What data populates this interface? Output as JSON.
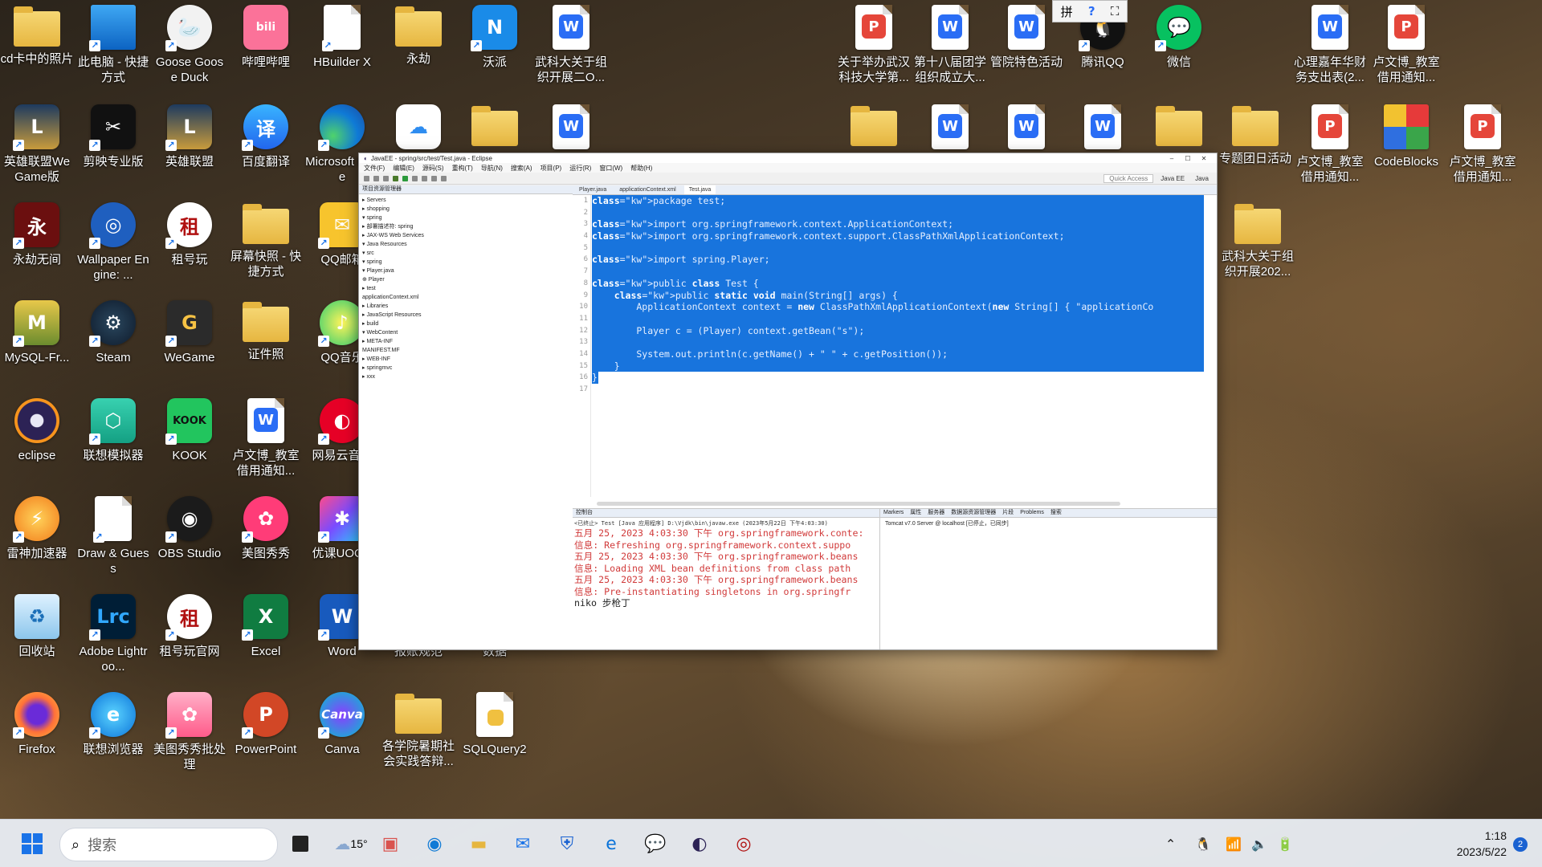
{
  "desktop": {
    "icons": [
      {
        "label": "cd卡中的照片"
      },
      {
        "label": "此电脑 - 快捷方式"
      },
      {
        "label": "Goose Goose Duck"
      },
      {
        "label": "哔哩哔哩"
      },
      {
        "label": "HBuilder X"
      },
      {
        "label": "永劫"
      },
      {
        "label": "沃派"
      },
      {
        "label": "武科大关于组织开展二O..."
      },
      {
        "label": "英雄联盟WeGame版"
      },
      {
        "label": "剪映专业版"
      },
      {
        "label": "英雄联盟"
      },
      {
        "label": "百度翻译"
      },
      {
        "label": "Microsoft Edge"
      },
      {
        "label": "永劫无间"
      },
      {
        "label": "Wallpaper Engine: ..."
      },
      {
        "label": "租号玩"
      },
      {
        "label": "屏幕快照 - 快捷方式"
      },
      {
        "label": "QQ邮箱"
      },
      {
        "label": "MySQL-Fr..."
      },
      {
        "label": "Steam"
      },
      {
        "label": "WeGame"
      },
      {
        "label": "证件照"
      },
      {
        "label": "QQ音乐"
      },
      {
        "label": "eclipse"
      },
      {
        "label": "联想模拟器"
      },
      {
        "label": "KOOK"
      },
      {
        "label": "卢文博_教室借用通知..."
      },
      {
        "label": "网易云音乐"
      },
      {
        "label": "雷神加速器"
      },
      {
        "label": "Draw & Guess"
      },
      {
        "label": "OBS Studio"
      },
      {
        "label": "美图秀秀"
      },
      {
        "label": "优课UOOC"
      },
      {
        "label": "回收站"
      },
      {
        "label": "Adobe Lightroo..."
      },
      {
        "label": "租号玩官网"
      },
      {
        "label": "Excel"
      },
      {
        "label": "Word"
      },
      {
        "label": "报账规范"
      },
      {
        "label": "数据"
      },
      {
        "label": "Firefox"
      },
      {
        "label": "联想浏览器"
      },
      {
        "label": "美图秀秀批处理"
      },
      {
        "label": "PowerPoint"
      },
      {
        "label": "Canva"
      },
      {
        "label": "各学院暑期社会实践答辩..."
      },
      {
        "label": "SQLQuery2"
      },
      {
        "label": "关于举办武汉科技大学第..."
      },
      {
        "label": "第十八届团学组织成立大..."
      },
      {
        "label": "管院特色活动"
      },
      {
        "label": "腾讯QQ"
      },
      {
        "label": "微信"
      },
      {
        "label": "心理嘉年华财务支出表(2..."
      },
      {
        "label": "卢文博_教室借用通知..."
      },
      {
        "label": "专题团日活动"
      },
      {
        "label": "卢文博_教室借用通知..."
      },
      {
        "label": "CodeBlocks"
      },
      {
        "label": "卢文博_教室借用通知..."
      },
      {
        "label": "武科大关于组织开展202..."
      }
    ]
  },
  "ime": {
    "mode": "拼",
    "help": "?"
  },
  "eclipse": {
    "title": "JavaEE - spring/src/test/Test.java - Eclipse",
    "menu": [
      "文件(F)",
      "编辑(E)",
      "源码(S)",
      "重构(T)",
      "导航(N)",
      "搜索(A)",
      "项目(P)",
      "运行(R)",
      "窗口(W)",
      "帮助(H)"
    ],
    "quick_access": "Quick Access",
    "perspectives": [
      "Java EE",
      "Java"
    ],
    "explorer_tab": "项目资源管理器",
    "tree": [
      "▸ Servers",
      "▸ shopping",
      "▾ spring",
      "  ▸ 部署描述符: spring",
      "  ▸ JAX-WS Web Services",
      "  ▾ Java Resources",
      "    ▾ src",
      "      ▾ spring",
      "        ▾ Player.java",
      "            ⊕ Player",
      "      ▸ test",
      "        applicationContext.xml",
      "    ▸ Libraries",
      "  ▸ JavaScript Resources",
      "  ▸ build",
      "  ▾ WebContent",
      "    ▸ META-INF",
      "      MANIFEST.MF",
      "    ▸ WEB-INF",
      "▸ springmvc",
      "▸ xxx"
    ],
    "editor_tabs": [
      "Player.java",
      "applicationContext.xml",
      "Test.java"
    ],
    "code": [
      "package test;",
      "",
      "import org.springframework.context.ApplicationContext;",
      "import org.springframework.context.support.ClassPathXmlApplicationContext;",
      "",
      "import spring.Player;",
      "",
      "public class Test {",
      "    public static void main(String[] args) {",
      "        ApplicationContext context = new ClassPathXmlApplicationContext(new String[] { \"applicationCo",
      "",
      "        Player c = (Player) context.getBean(\"s\");",
      "",
      "        System.out.println(c.getName() + \" \" + c.getPosition());",
      "    }",
      "}",
      ""
    ],
    "line_numbers": [
      "1",
      "2",
      "3",
      "4",
      "5",
      "6",
      "7",
      "8",
      "9",
      "10",
      "11",
      "12",
      "13",
      "14",
      "15",
      "16",
      "17"
    ],
    "console": {
      "tab": "控制台",
      "header": "<已终止> Test [Java 应用程序] D:\\Vjdk\\bin\\javaw.exe (2023年5月22日 下午4:03:30)",
      "lines": [
        "五月 25, 2023 4:03:30 下午 org.springframework.conte:",
        "信息: Refreshing org.springframework.context.suppo",
        "五月 25, 2023 4:03:30 下午 org.springframework.beans",
        "信息: Loading XML bean definitions from class path",
        "五月 25, 2023 4:03:30 下午 org.springframework.beans",
        "信息: Pre-instantiating singletons in org.springfr",
        "niko 步枪丁"
      ]
    },
    "servers": {
      "tabs": [
        "Markers",
        "属性",
        "服务器",
        "数据源资源管理器",
        "片段",
        "Problems",
        "搜索"
      ],
      "item": "Tomcat v7.0 Server @ localhost  [已停止，已同步]"
    }
  },
  "taskbar": {
    "search_placeholder": "搜索",
    "weather": "15°",
    "clock_time": "1:18",
    "clock_date": "2023/5/22",
    "notifications": "2"
  }
}
